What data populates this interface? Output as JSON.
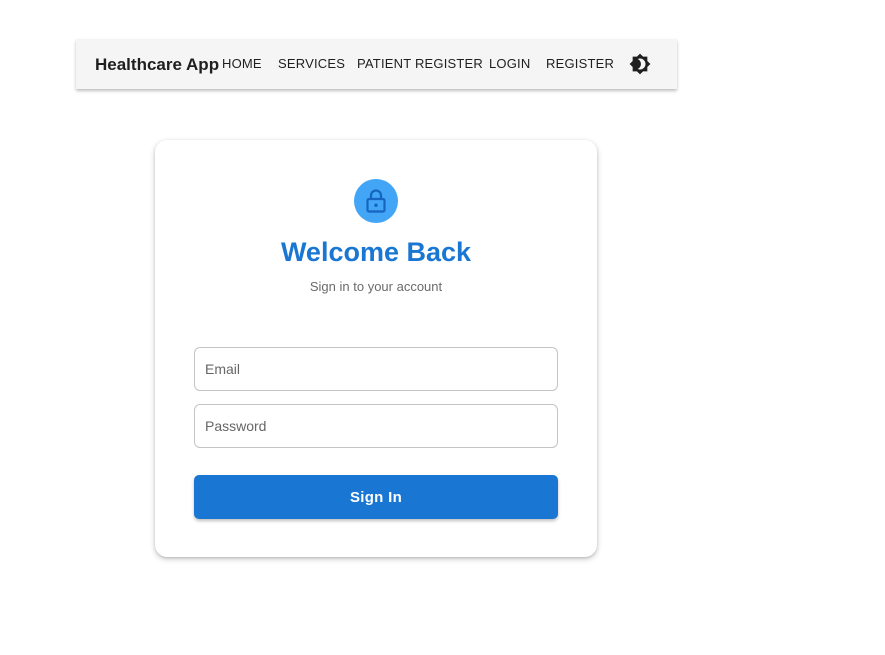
{
  "header": {
    "brand": "Healthcare App",
    "nav": {
      "home": "HOME",
      "services": "SERVICES",
      "patient_register": "PATIENT REGISTER",
      "login": "LOGIN",
      "register": "REGISTER"
    },
    "theme_icon": "brightness-toggle-icon"
  },
  "login_card": {
    "icon": "lock-icon",
    "title": "Welcome Back",
    "subtitle": "Sign in to your account",
    "email_placeholder": "Email",
    "password_placeholder": "Password",
    "submit_label": "Sign In"
  },
  "colors": {
    "primary": "#1976d2",
    "avatar": "#42a5f5",
    "appbar_bg": "#f5f5f5"
  }
}
